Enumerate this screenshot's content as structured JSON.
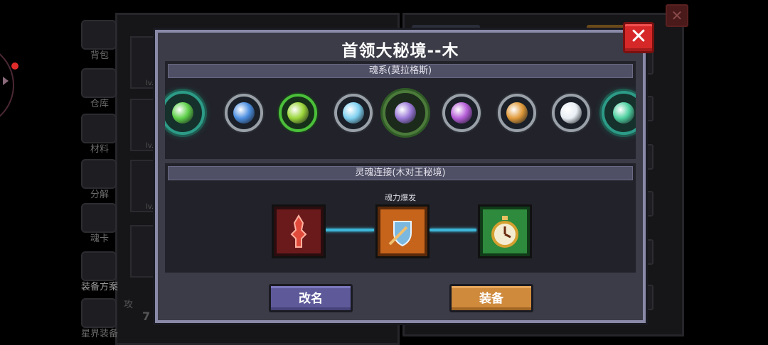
{
  "background": {
    "sidebar": [
      {
        "label": "背包",
        "icon": "backpack-icon"
      },
      {
        "label": "仓库",
        "icon": "warehouse-icon"
      },
      {
        "label": "材料",
        "icon": "materials-icon"
      },
      {
        "label": "分解",
        "icon": "decompose-icon"
      },
      {
        "label": "魂卡",
        "icon": "soul-card-icon"
      },
      {
        "label": "装备方案",
        "icon": "equipment-plan-icon"
      },
      {
        "label": "星界装备",
        "icon": "astral-equipment-icon"
      }
    ],
    "slot_level_label": "lv.",
    "attack_label": "攻",
    "attack_value_fragment": "7"
  },
  "dialog": {
    "title": "首领大秘境--木",
    "close_label": "✕",
    "souls_section": {
      "header": "魂系(莫拉格斯)",
      "souls": [
        {
          "icon": "green-orb-ornate-icon",
          "color": "#5fd14a"
        },
        {
          "icon": "blue-swirl-icon",
          "color": "#4d8fe0"
        },
        {
          "icon": "green-rune-icon",
          "color": "#9ad63a"
        },
        {
          "icon": "ice-arrow-icon",
          "color": "#7fd0f0"
        },
        {
          "icon": "sigil-wreath-icon",
          "color": "#9c7ad8"
        },
        {
          "icon": "purple-flower-icon",
          "color": "#b65fd8"
        },
        {
          "icon": "orange-shield-icon",
          "color": "#e09a3a"
        },
        {
          "icon": "white-pearl-icon",
          "color": "#e8eef4"
        },
        {
          "icon": "green-claw-ornate-icon",
          "color": "#4fd0a0"
        }
      ]
    },
    "link_section": {
      "header": "灵魂连接(木对王秘境)",
      "sublabel": "魂力爆发",
      "nodes": [
        {
          "icon": "red-totem-icon"
        },
        {
          "icon": "sword-shield-icon"
        },
        {
          "icon": "golden-clock-icon"
        }
      ]
    },
    "buttons": {
      "rename": "改名",
      "equip": "装备"
    }
  }
}
